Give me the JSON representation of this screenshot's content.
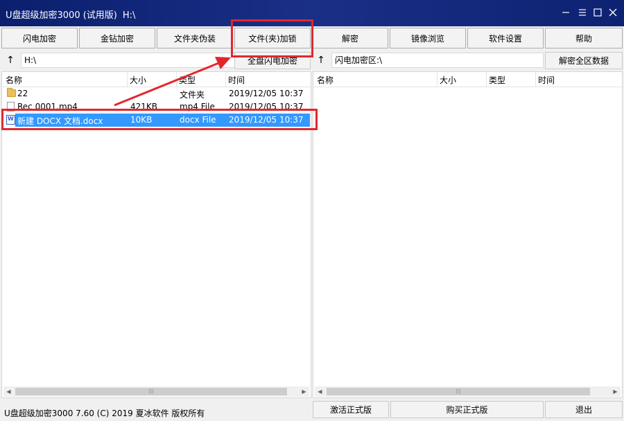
{
  "window": {
    "title": "U盘超级加密3000 (试用版)",
    "path": "H:\\",
    "minimize_icon": "minimize-icon",
    "maximize_icon": "maximize-icon",
    "close_icon": "close-icon"
  },
  "toolbar": {
    "buttons": [
      "闪电加密",
      "金钻加密",
      "文件夹伪装",
      "文件(夹)加锁",
      "解密",
      "镜像浏览",
      "软件设置",
      "帮助"
    ]
  },
  "left": {
    "path": "H:\\",
    "action_button": "全盘闪电加密",
    "columns": [
      "名称",
      "大小",
      "类型",
      "时间"
    ],
    "rows": [
      {
        "name": "22",
        "size": "",
        "type": "文件夹",
        "time": "2019/12/05 10:37",
        "icon": "folder-icon"
      },
      {
        "name": "Rec 0001.mp4",
        "size": "421KB",
        "type": "mp4 File",
        "time": "2019/12/05 10:37",
        "icon": "file-icon"
      },
      {
        "name": "新建 DOCX 文档.docx",
        "size": "10KB",
        "type": "docx File",
        "time": "2019/12/05 10:37",
        "icon": "docx-icon",
        "selected": true
      }
    ]
  },
  "right": {
    "path": "闪电加密区:\\",
    "action_button": "解密全区数据",
    "columns": [
      "名称",
      "大小",
      "类型",
      "时间"
    ]
  },
  "status": {
    "text": "U盘超级加密3000 7.60 (C) 2019 夏冰软件 版权所有",
    "buttons": [
      "激活正式版",
      "购买正式版",
      "退出"
    ]
  },
  "colors": {
    "titlebar": "#0b1f6e",
    "selection": "#3399ff",
    "annotation": "#e3262c"
  }
}
